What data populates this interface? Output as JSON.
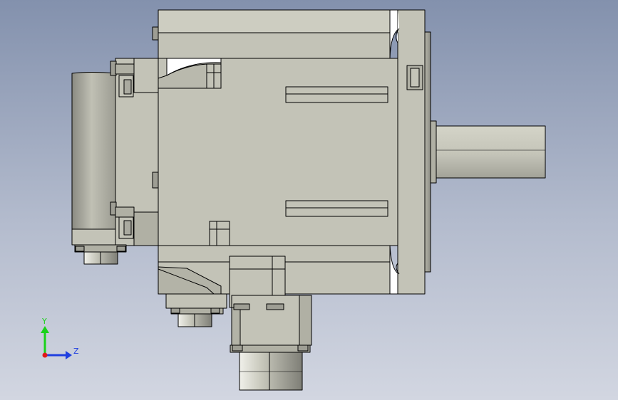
{
  "view": {
    "background_top": "#8391ad",
    "background_bottom": "#d2d6e1",
    "part_fill": "#c3c3b7",
    "part_light": "#d1d1c5",
    "part_shadow": "#8f8f85",
    "outline": "#000000"
  },
  "triad": {
    "y_label": "Y",
    "z_label": "Z",
    "y_color": "#19d219",
    "z_color": "#1f3fe0",
    "x_color": "#e01818"
  }
}
